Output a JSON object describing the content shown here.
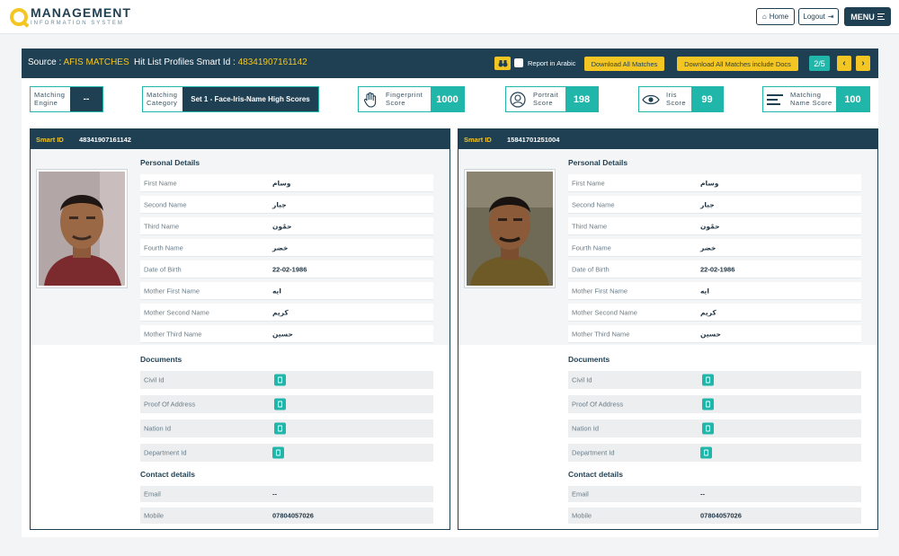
{
  "nav": {
    "logo_main": "MANAGEMENT",
    "logo_sub": "INFORMATION SYSTEM",
    "home_label": "Home",
    "logout_label": "Logout",
    "menu_label": "MENU"
  },
  "header": {
    "source_label": "Source :",
    "source_value": "AFIS MATCHES",
    "hitlist_label": "Hit List Profiles Smart Id :",
    "hitlist_value": "48341907161142",
    "report_arabic_label": "Report in Arabic",
    "download_all_label": "Download All Matches",
    "download_docs_label": "Download All Matches include Docs",
    "page_indicator": "2/5"
  },
  "scores": {
    "engine_label": "Matching Engine",
    "engine_value": "--",
    "category_label": "Matching Category",
    "category_value": "Set 1 - Face-Iris-Name High Scores",
    "fingerprint_label": "Fingerprint Score",
    "fingerprint_value": "1000",
    "portrait_label": "Portrait Score",
    "portrait_value": "198",
    "iris_label": "Iris Score",
    "iris_value": "99",
    "name_label": "Matching Name Score",
    "name_value": "100"
  },
  "labels": {
    "smart_id": "Smart ID",
    "personal_details": "Personal Details",
    "documents": "Documents",
    "contact_details": "Contact details",
    "first_name": "First Name",
    "second_name": "Second Name",
    "third_name": "Third Name",
    "fourth_name": "Fourth Name",
    "dob": "Date of Birth",
    "mother_first": "Mother First Name",
    "mother_second": "Mother Second Name",
    "mother_third": "Mother Third Name",
    "civil_id": "Civil Id",
    "proof_address": "Proof Of Address",
    "nation_id": "Nation Id",
    "department_id": "Department Id",
    "email": "Email",
    "mobile": "Mobile"
  },
  "profiles": [
    {
      "smart_id": "48341907161142",
      "first_name": "وسام",
      "second_name": "جبار",
      "third_name": "حمْون",
      "fourth_name": "خضر",
      "dob": "22-02-1986",
      "mother_first": "ايه",
      "mother_second": "كريم",
      "mother_third": "حسين",
      "email": "--",
      "mobile": "07804057026"
    },
    {
      "smart_id": "15841701251004",
      "first_name": "وسام",
      "second_name": "جبار",
      "third_name": "حمْون",
      "fourth_name": "خضر",
      "dob": "22-02-1986",
      "mother_first": "ايه",
      "mother_second": "كريم",
      "mother_third": "حسين",
      "email": "--",
      "mobile": "07804057026"
    }
  ],
  "colors": {
    "navy": "#1f3f52",
    "teal": "#20b6aa",
    "yellow": "#f3c623"
  }
}
